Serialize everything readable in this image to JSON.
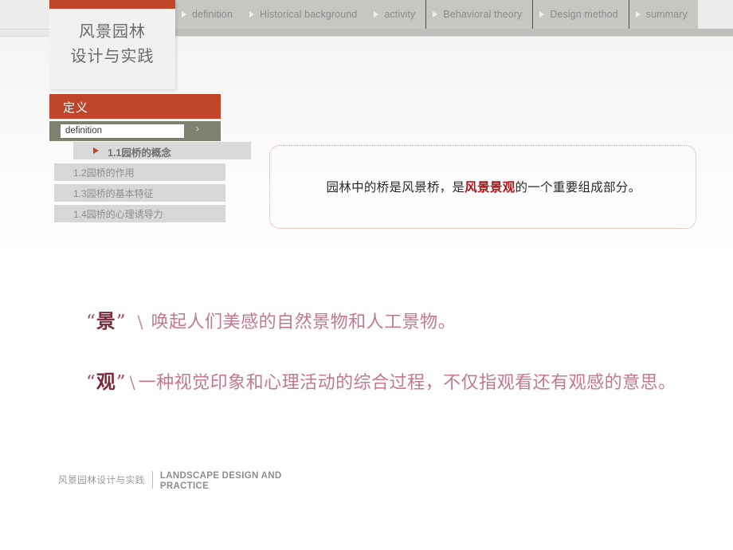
{
  "slide": {
    "title_card": {
      "line1": "风景园林",
      "line2": "设计与实践"
    }
  },
  "nav": {
    "groups": [
      {
        "items": [
          {
            "label": "definition",
            "icon": "triangle-right-icon"
          },
          {
            "label": "Historical background",
            "icon": "triangle-right-icon"
          },
          {
            "label": "activity",
            "icon": "triangle-right-icon"
          }
        ]
      },
      {
        "items": [
          {
            "label": "Behavioral theory",
            "icon": "triangle-right-icon"
          },
          {
            "label": "Design method",
            "icon": "triangle-right-icon"
          },
          {
            "label": "summary",
            "icon": "triangle-right-icon"
          }
        ]
      }
    ]
  },
  "sidebar": {
    "section_title": "定义",
    "search_value": "definition",
    "search_chevron": "›",
    "items": [
      {
        "label": "1.1园桥的概念",
        "active": true
      },
      {
        "label": "1.2园桥的作用",
        "active": false
      },
      {
        "label": "1.3园桥的基本特征",
        "active": false
      },
      {
        "label": "1.4园桥的心理诱导力",
        "active": false
      }
    ]
  },
  "callout": {
    "text_before": "园林中的桥是风景桥，是",
    "text_highlight": "风景景观",
    "text_after": "的一个重要组成部分。"
  },
  "body": {
    "line1": {
      "quote_open": "“",
      "keyword": "景",
      "quote_close": "”",
      "slash": "\\",
      "text": "唤起人们美感的自然景物和人工景物。"
    },
    "line2": {
      "quote_open": "“",
      "keyword": "观",
      "quote_close": "”",
      "slash": "\\",
      "text": "一种视觉印象和心理活动的综合过程，不仅指观看还有观感的意思。"
    }
  },
  "footer": {
    "cn": "风景园林设计与实践",
    "en": "LANDSCAPE DESIGN AND PRACTICE"
  },
  "colors": {
    "accent_orange": "#c0452a",
    "olive": "#7e8070",
    "highlight_red": "#b5121b",
    "body_pink": "#c4788c",
    "nav_gray": "#c6c6c2"
  }
}
